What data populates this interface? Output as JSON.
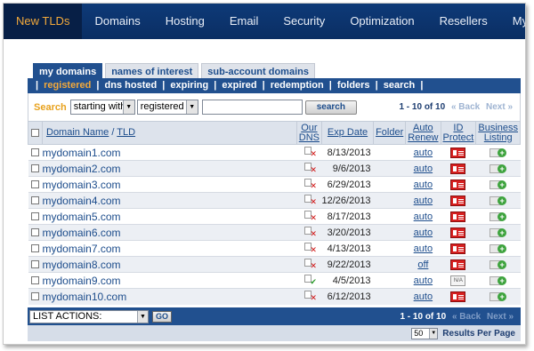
{
  "nav": {
    "items": [
      {
        "label": "New TLDs",
        "active": true
      },
      {
        "label": "Domains"
      },
      {
        "label": "Hosting"
      },
      {
        "label": "Email"
      },
      {
        "label": "Security"
      },
      {
        "label": "Optimization"
      },
      {
        "label": "Resellers"
      },
      {
        "label": "My Account"
      }
    ]
  },
  "tabs": [
    {
      "label": "my domains",
      "active": true
    },
    {
      "label": "names of interest"
    },
    {
      "label": "sub-account domains"
    }
  ],
  "filters": [
    "registered",
    "dns hosted",
    "expiring",
    "expired",
    "redemption",
    "folders",
    "search"
  ],
  "active_filter": "registered",
  "search": {
    "label": "Search",
    "mode": "starting with",
    "scope": "registered",
    "query": "",
    "button": "search"
  },
  "pager": {
    "range": "1 - 10 of 10",
    "back": "« Back",
    "next": "Next »"
  },
  "columns": {
    "domain_name": "Domain Name",
    "tld": "TLD",
    "our_dns_1": "Our",
    "our_dns_2": "DNS",
    "exp_date": "Exp Date",
    "folder": "Folder",
    "auto_1": "Auto",
    "auto_2": "Renew",
    "id_1": "ID",
    "id_2": "Protect",
    "biz_1": "Business",
    "biz_2": "Listing"
  },
  "rows": [
    {
      "domain": "mydomain1.com",
      "dns": "no",
      "exp": "8/13/2013",
      "auto": "auto",
      "id": "protect"
    },
    {
      "domain": "mydomain2.com",
      "dns": "no",
      "exp": "9/6/2013",
      "auto": "auto",
      "id": "protect"
    },
    {
      "domain": "mydomain3.com",
      "dns": "no",
      "exp": "6/29/2013",
      "auto": "auto",
      "id": "protect"
    },
    {
      "domain": "mydomain4.com",
      "dns": "no",
      "exp": "12/26/2013",
      "auto": "auto",
      "id": "protect"
    },
    {
      "domain": "mydomain5.com",
      "dns": "no",
      "exp": "8/17/2013",
      "auto": "auto",
      "id": "protect"
    },
    {
      "domain": "mydomain6.com",
      "dns": "no",
      "exp": "3/20/2013",
      "auto": "auto",
      "id": "protect"
    },
    {
      "domain": "mydomain7.com",
      "dns": "no",
      "exp": "4/13/2013",
      "auto": "auto",
      "id": "protect"
    },
    {
      "domain": "mydomain8.com",
      "dns": "no",
      "exp": "9/22/2013",
      "auto": "off",
      "id": "protect"
    },
    {
      "domain": "mydomain9.com",
      "dns": "yes",
      "exp": "4/5/2013",
      "auto": "auto",
      "id": "N/A"
    },
    {
      "domain": "mydomain10.com",
      "dns": "no",
      "exp": "6/12/2013",
      "auto": "auto",
      "id": "protect"
    }
  ],
  "actions": {
    "label": "LIST ACTIONS:",
    "go": "GO"
  },
  "footer": {
    "per_page_value": "50",
    "per_page_label": "Results Per Page"
  },
  "colors": {
    "nav_bg": "#0e3a78",
    "accent": "#f2a93b",
    "bar": "#21508f",
    "link": "#1d4d8c"
  }
}
